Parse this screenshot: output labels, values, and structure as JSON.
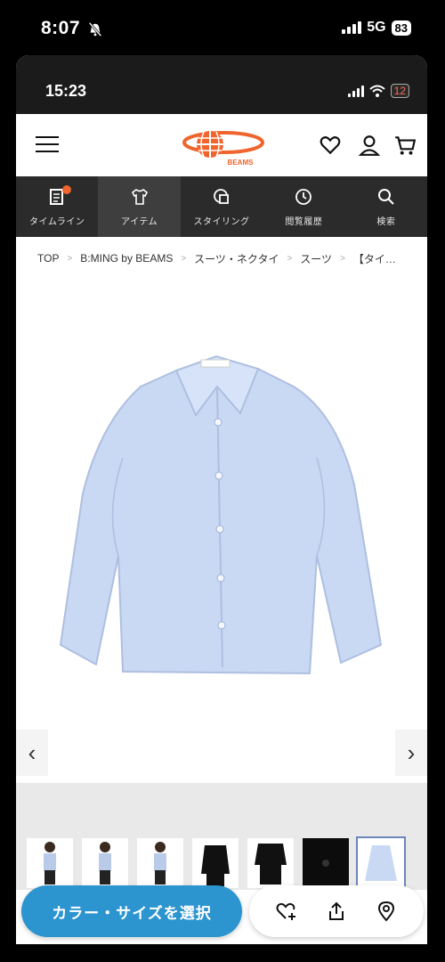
{
  "outer_status": {
    "time": "8:07",
    "network": "5G",
    "battery": "83"
  },
  "inner_status": {
    "time": "15:23",
    "battery": "12"
  },
  "header": {
    "logo_text": "BEAMS",
    "icons": [
      "menu-icon",
      "heart-icon",
      "user-icon",
      "cart-icon"
    ]
  },
  "nav": {
    "items": [
      {
        "label": "タイムライン",
        "icon": "timeline-icon"
      },
      {
        "label": "アイテム",
        "icon": "tshirt-icon"
      },
      {
        "label": "スタイリング",
        "icon": "styling-icon"
      },
      {
        "label": "閲覧履歴",
        "icon": "clock-icon"
      },
      {
        "label": "検索",
        "icon": "search-icon"
      }
    ]
  },
  "breadcrumb": [
    "TOP",
    "B:MING by BEAMS",
    "スーツ・ネクタイ",
    "スーツ",
    "【タイ…"
  ],
  "product": {
    "prev": "‹",
    "next": "›"
  },
  "cta": {
    "label": "カラー・サイズを選択"
  },
  "colors": {
    "accent": "#2c94cf",
    "brand": "#f0642d",
    "nav_bg": "#2b2b2b"
  }
}
